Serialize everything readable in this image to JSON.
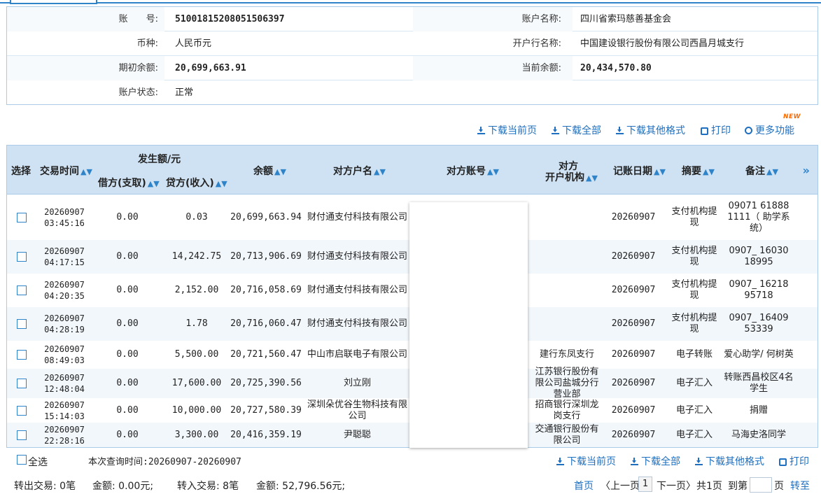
{
  "account": {
    "account_no_label": "账　　号:",
    "account_no": "51001815208051506397",
    "account_name_label": "账户名称:",
    "account_name": "四川省索玛慈善基金会",
    "currency_label": "币种:",
    "currency": "人民币元",
    "bank_label": "开户行名称:",
    "bank": "中国建设银行股份有限公司西昌月城支行",
    "opening_label": "期初余额:",
    "opening": "20,699,663.91",
    "current_label": "当前余额:",
    "current": "20,434,570.80",
    "status_label": "账户状态:",
    "status": "正常"
  },
  "toolbar": {
    "download_page": "下载当前页",
    "download_all": "下载全部",
    "download_other": "下载其他格式",
    "print": "打印",
    "more": "更多功能",
    "new_badge": "NEW"
  },
  "table": {
    "headers": {
      "select": "选择",
      "time": "交易时间",
      "amount_group": "发生额/元",
      "debit": "借方(支取)",
      "credit": "贷方(收入)",
      "balance": "余额",
      "party_name": "对方户名",
      "party_account": "对方账号",
      "party_bank_1": "对方",
      "party_bank_2": "开户机构",
      "post_date": "记账日期",
      "summary": "摘要",
      "remark": "备注",
      "more_cols": "»"
    },
    "rows": [
      {
        "date": "20260907",
        "time": "03:45:16",
        "debit": "0.00",
        "credit": "0.03",
        "balance": "20,699,663.94",
        "party": "财付通支付科技有限公司",
        "bank": "",
        "post": "20260907",
        "summary": "支付机构提现",
        "remark": "09071 61888 1111（ 助学系统）"
      },
      {
        "date": "20260907",
        "time": "04:17:15",
        "debit": "0.00",
        "credit": "14,242.75",
        "balance": "20,713,906.69",
        "party": "财付通支付科技有限公司",
        "bank": "",
        "post": "20260907",
        "summary": "支付机构提现",
        "remark": "0907_ 16030 18995"
      },
      {
        "date": "20260907",
        "time": "04:20:35",
        "debit": "0.00",
        "credit": "2,152.00",
        "balance": "20,716,058.69",
        "party": "财付通支付科技有限公司",
        "bank": "",
        "post": "20260907",
        "summary": "支付机构提现",
        "remark": "0907_ 16218 95718"
      },
      {
        "date": "20260907",
        "time": "04:28:19",
        "debit": "0.00",
        "credit": "1.78",
        "balance": "20,716,060.47",
        "party": "财付通支付科技有限公司",
        "bank": "",
        "post": "20260907",
        "summary": "支付机构提现",
        "remark": "0907_ 16409 53339"
      },
      {
        "date": "20260907",
        "time": "08:49:03",
        "debit": "0.00",
        "credit": "5,500.00",
        "balance": "20,721,560.47",
        "party": "中山市启联电子有限公司",
        "bank": "建行东凤支行",
        "post": "20260907",
        "summary": "电子转账",
        "remark": "爱心助学/ 何树英"
      },
      {
        "date": "20260907",
        "time": "12:48:04",
        "debit": "0.00",
        "credit": "17,600.00",
        "balance": "20,725,390.56",
        "party": "刘立刚",
        "bank": "江苏银行股份有限公司盐城分行营业部",
        "post": "20260907",
        "summary": "电子汇入",
        "remark": "转账西昌校区4名学生"
      },
      {
        "date": "20260907",
        "time": "15:14:03",
        "debit": "0.00",
        "credit": "10,000.00",
        "balance": "20,727,580.39",
        "party": "深圳朵优谷生物科技有限公司",
        "bank": "招商银行深圳龙岗支行",
        "post": "20260907",
        "summary": "电子汇入",
        "remark": "捐赠"
      },
      {
        "date": "20260907",
        "time": "22:28:16",
        "debit": "0.00",
        "credit": "3,300.00",
        "balance": "20,416,359.19",
        "party": "尹聪聪",
        "bank": "交通银行股份有限公司",
        "post": "20260907",
        "summary": "电子汇入",
        "remark": "马海史洛同学"
      }
    ]
  },
  "footer": {
    "select_all": "全选",
    "query_time": "本次查询时间:20260907-20260907",
    "download_page": "下载当前页",
    "download_all": "下载全部",
    "download_other": "下载其他格式",
    "print": "打印",
    "out_tx": "转出交易: 0笔",
    "out_amt": "金额: 0.00元;",
    "in_tx": "转入交易: 8笔",
    "in_amt": "金额: 52,796.56元;",
    "first": "首页",
    "prev": "〈上一页",
    "page_no": "1",
    "next": "下一页〉",
    "total": "共1页",
    "goto": "到第",
    "page_unit": "页",
    "jump": "转至"
  }
}
